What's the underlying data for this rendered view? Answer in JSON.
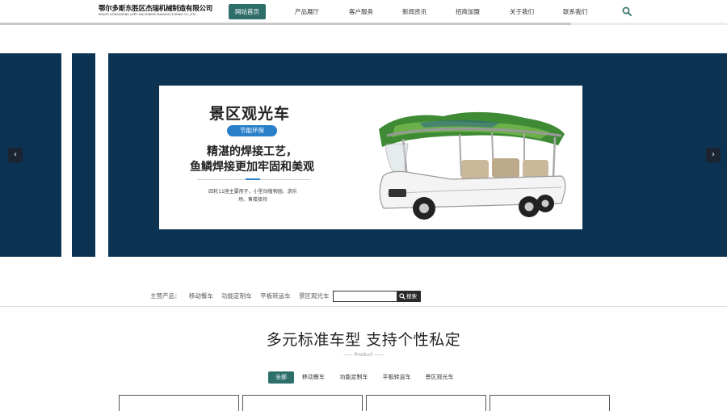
{
  "header": {
    "logo_main": "鄂尔多斯东胜区杰瑞机械制造有限公司",
    "logo_sub": "ERDOS DONGSHENG JIERY MACHINERY MANUFACTURING CO.,LTD.",
    "nav": [
      {
        "label": "网站首页",
        "active": true
      },
      {
        "label": "产品展厅"
      },
      {
        "label": "客户服务"
      },
      {
        "label": "新闻资讯"
      },
      {
        "label": "招商加盟"
      },
      {
        "label": "关于我们"
      },
      {
        "label": "联系我们"
      }
    ],
    "search_icon": "search-icon",
    "scroll_progress": 0.785
  },
  "banner": {
    "title": "景区观光车",
    "badge": "节能环保",
    "headline_1": "精湛的焊接工艺，",
    "headline_2": "鱼鳞焊接更加牢固和美观",
    "description": "四轮11座主要用于，小型动植物园、游乐场、售楼接待",
    "prev_label": "‹",
    "next_label": "›",
    "background": "#0d3352",
    "accent": "#2a7fc9"
  },
  "search_row": {
    "label": "主营产品：",
    "products": [
      "移动餐车",
      "功能定制车",
      "平板转运车",
      "景区观光车"
    ],
    "input_value": "",
    "button_label": "搜索"
  },
  "section": {
    "title": "多元标准车型 支持个性私定",
    "subtitle": "—— Product ——"
  },
  "tabs": [
    {
      "label": "全部",
      "active": true
    },
    {
      "label": "移动餐车"
    },
    {
      "label": "功能定制车"
    },
    {
      "label": "平板转运车"
    },
    {
      "label": "景区观光车"
    }
  ],
  "colors": {
    "brand": "#2f6f6a",
    "banner_bg": "#0d3352"
  }
}
